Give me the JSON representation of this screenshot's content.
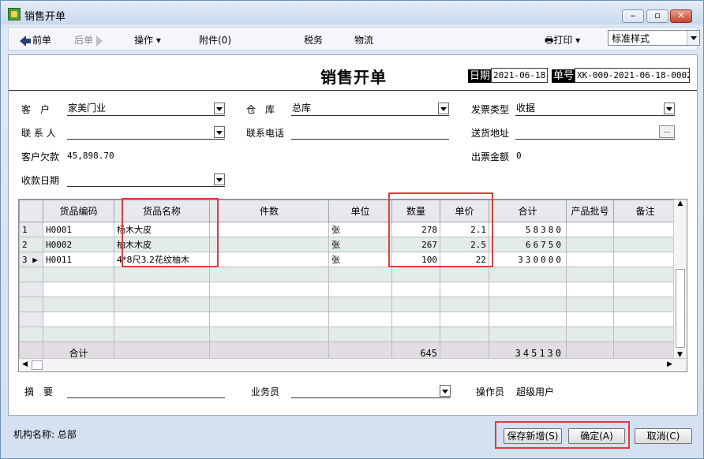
{
  "window": {
    "title": "销售开单",
    "min": "‒",
    "max": "▫",
    "close": "✕"
  },
  "toolbar": {
    "prev": "前单",
    "next": "后单",
    "operations": "操作",
    "attachment": "附件(0)",
    "tax": "税务",
    "logistics": "物流",
    "print": "打印",
    "style_select": "标准样式"
  },
  "doc": {
    "title": "销售开单",
    "date_label": "日期",
    "date_value": "2021-06-18",
    "no_label": "单号",
    "no_value": "XK-000-2021-06-18-0002"
  },
  "form": {
    "customer_label": "客　户",
    "customer_value": "家美门业",
    "warehouse_label": "仓　库",
    "warehouse_value": "总库",
    "invoice_type_label": "发票类型",
    "invoice_type_value": "收据",
    "contact_label": "联 系 人",
    "contact_value": "",
    "phone_label": "联系电话",
    "phone_value": "",
    "address_label": "送货地址",
    "address_value": "",
    "debt_label": "客户欠款",
    "debt_value": "45,898.70",
    "invoice_amount_label": "出票金额",
    "invoice_amount_value": "0",
    "collect_date_label": "收款日期",
    "collect_date_value": ""
  },
  "grid": {
    "headers": [
      "货品编码",
      "货品名称",
      "件数",
      "单位",
      "数量",
      "单价",
      "合计",
      "产品批号",
      "备注"
    ],
    "rows": [
      {
        "no": "1",
        "code": "H0001",
        "name": "杨木大皮",
        "pieces": "",
        "unit": "张",
        "qty": "278",
        "price": "2.1",
        "total": "58380",
        "batch": "",
        "remark": ""
      },
      {
        "no": "2",
        "code": "H0002",
        "name": "柚木木皮",
        "pieces": "",
        "unit": "张",
        "qty": "267",
        "price": "2.5",
        "total": "66750",
        "batch": "",
        "remark": ""
      },
      {
        "no": "3",
        "code": "H0011",
        "name": "4*8尺3.2花纹柚木",
        "pieces": "",
        "unit": "张",
        "qty": "100",
        "price": "22",
        "total": "330000",
        "batch": "",
        "remark": ""
      }
    ],
    "summary": {
      "label": "合计",
      "qty": "645",
      "total": "345130"
    }
  },
  "footer": {
    "summary_label": "摘　要",
    "summary_value": "",
    "salesperson_label": "业务员",
    "salesperson_value": "",
    "operator_label": "操作员",
    "operator_value": "超级用户"
  },
  "status": {
    "org": "机构名称: 总部"
  },
  "buttons": {
    "save_new": "保存新增(S)",
    "confirm": "确定(A)",
    "cancel": "取消(C)"
  },
  "colors": {
    "highlight": "#e23b3b",
    "accent": "#2a3e7a"
  }
}
